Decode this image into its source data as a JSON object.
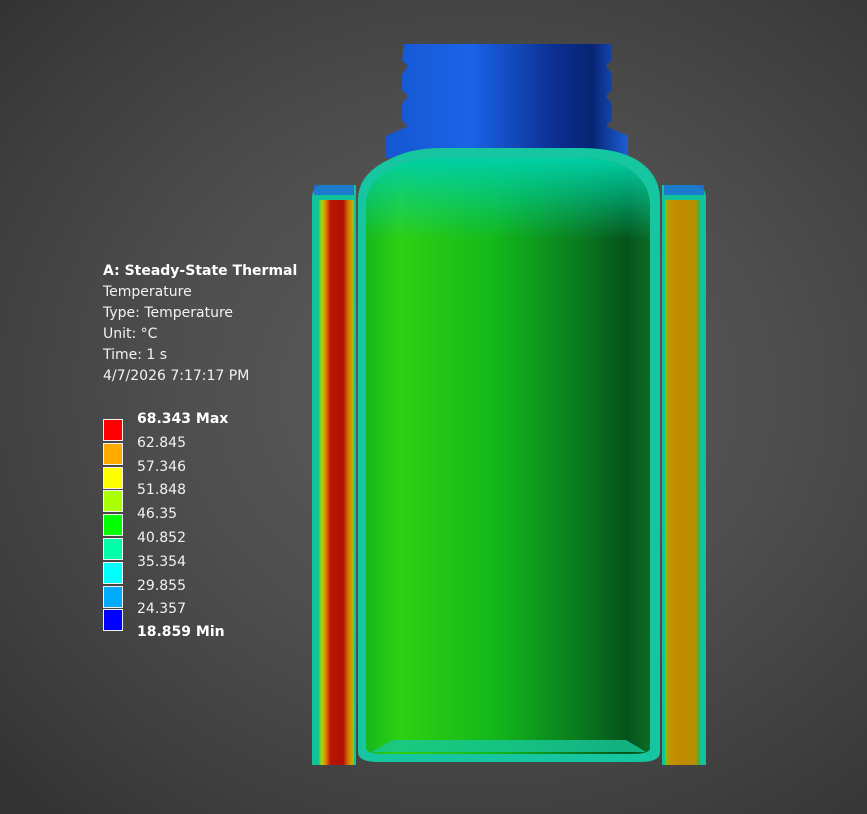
{
  "result": {
    "title": "A: Steady-State Thermal",
    "name": "Temperature",
    "type_line": "Type: Temperature",
    "unit_line": "Unit: °C",
    "time_line": "Time: 1 s",
    "timestamp": "4/7/2026 7:17:17 PM"
  },
  "legend": {
    "max_label": "68.343 Max",
    "min_label": "18.859 Min",
    "ticks": [
      "62.845",
      "57.346",
      "51.848",
      "46.35",
      "40.852",
      "35.354",
      "29.855",
      "24.357"
    ],
    "colors": [
      "#ff0000",
      "#ffaa00",
      "#ffff00",
      "#aaff00",
      "#00ff00",
      "#00ffaa",
      "#00ffff",
      "#00aaff",
      "#0000ff"
    ]
  }
}
